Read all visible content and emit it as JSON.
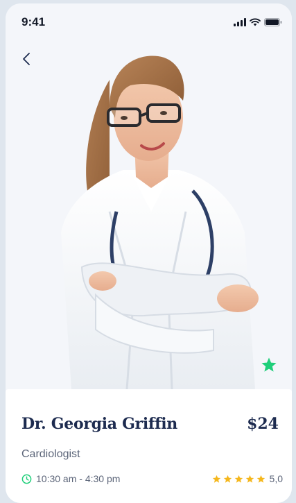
{
  "status_bar": {
    "time": "9:41",
    "icons": [
      "signal-icon",
      "wifi-icon",
      "battery-icon"
    ]
  },
  "header": {
    "back_icon": "chevron-left-icon"
  },
  "doctor": {
    "name": "Dr. Georgia Griffin",
    "specialty": "Cardiologist",
    "price": "$24",
    "hours": "10:30 am - 4:30 pm",
    "rating": "5,0",
    "rating_stars": 5,
    "is_favorite": true
  },
  "colors": {
    "accent_green": "#1fcf7a",
    "star_gold": "#f5b71c",
    "heading_navy": "#1d2b4f",
    "muted_text": "#5b6478",
    "background": "#f4f6fa"
  }
}
